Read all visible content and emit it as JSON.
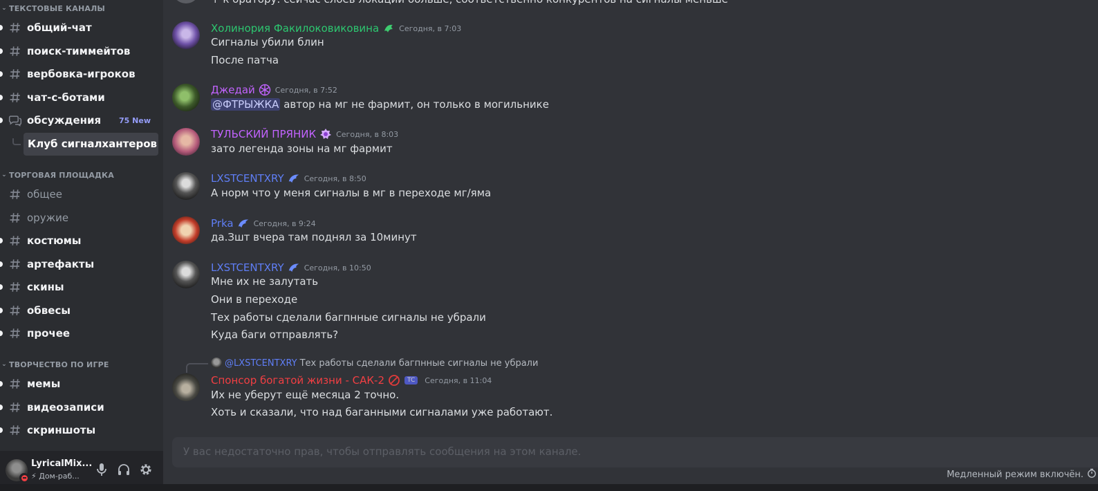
{
  "sidebar": {
    "categories": {
      "text": "ТЕКСТОВЫЕ КАНАЛЫ",
      "trade": "ТОРГОВАЯ ПЛОЩАДКА",
      "creative": "ТВОРЧЕСТВО ПО ИГРЕ"
    },
    "channels": {
      "c1": "общий-чат",
      "c2": "поиск-тиммейтов",
      "c3": "вербовка-игроков",
      "c4": "чат-с-ботами",
      "c5": "обсуждения",
      "c5_badge": "75 New",
      "thread": "Клуб сигналхантеров",
      "t1": "общее",
      "t2": "оружие",
      "t3": "костюмы",
      "t4": "артефакты",
      "t5": "скины",
      "t6": "обвесы",
      "t7": "прочее",
      "v1": "мемы",
      "v2": "видеозаписи",
      "v3": "скриншоты"
    }
  },
  "user_panel": {
    "name": "LyricalMix...",
    "status": "⚡ Дом-раб..."
  },
  "chat": {
    "partial_top": "+ к оратору: сейчас слоев локаций больше, соответственно конкурентов на сигналы меньше",
    "messages": [
      {
        "author": "Холинория Факилоковиковина",
        "color": "#2dc770",
        "time": "Сегодня, в 7:03",
        "lines": [
          "Сигналы убили блин",
          "После патча"
        ]
      },
      {
        "author": "Джедай",
        "color": "#c263ff",
        "time": "Сегодня, в 7:52",
        "mention": "@ФТРЫЖКА",
        "lines": [
          " автор на мг не фармит, он только в могильнике"
        ]
      },
      {
        "author": "ТУЛЬСКИЙ ПРЯНИК",
        "color": "#c263ff",
        "time": "Сегодня, в 8:03",
        "lines": [
          "зато легенда зоны на мг фармит"
        ]
      },
      {
        "author": "LXSTCENTXRY",
        "color": "#5f7ef5",
        "time": "Сегодня, в 8:50",
        "lines": [
          "А норм что у меня сигналы в мг в переходе мг/яма"
        ]
      },
      {
        "author": "Prka",
        "color": "#5f7ef5",
        "time": "Сегодня, в 9:24",
        "lines": [
          "да.Зшт вчера там поднял за 10минут"
        ]
      },
      {
        "author": "LXSTCENTXRY",
        "color": "#5f7ef5",
        "time": "Сегодня, в 10:50",
        "lines": [
          "Мне их не залутать",
          "Они в переходе",
          "Тех работы сделали багпнные сигналы не убрали",
          "Куда баги отправлять?"
        ]
      },
      {
        "author": "Спонсор богатой жизни - САК-2",
        "color": "#f23f43",
        "time": "Сегодня, в 11:04",
        "tag": "TC",
        "reply_author": "@LXSTCENTXRY",
        "reply_text": "Тех работы сделали багпнные сигналы не убрали",
        "lines": [
          "Их не уберут ещё месяца 2 точно.",
          "Хоть и сказали, что над баганными сигналами уже работают."
        ]
      }
    ],
    "input_placeholder": "У вас недостаточно прав, чтобы отправлять сообщения на этом канале.",
    "slowmode": "Медленный режим включён."
  }
}
